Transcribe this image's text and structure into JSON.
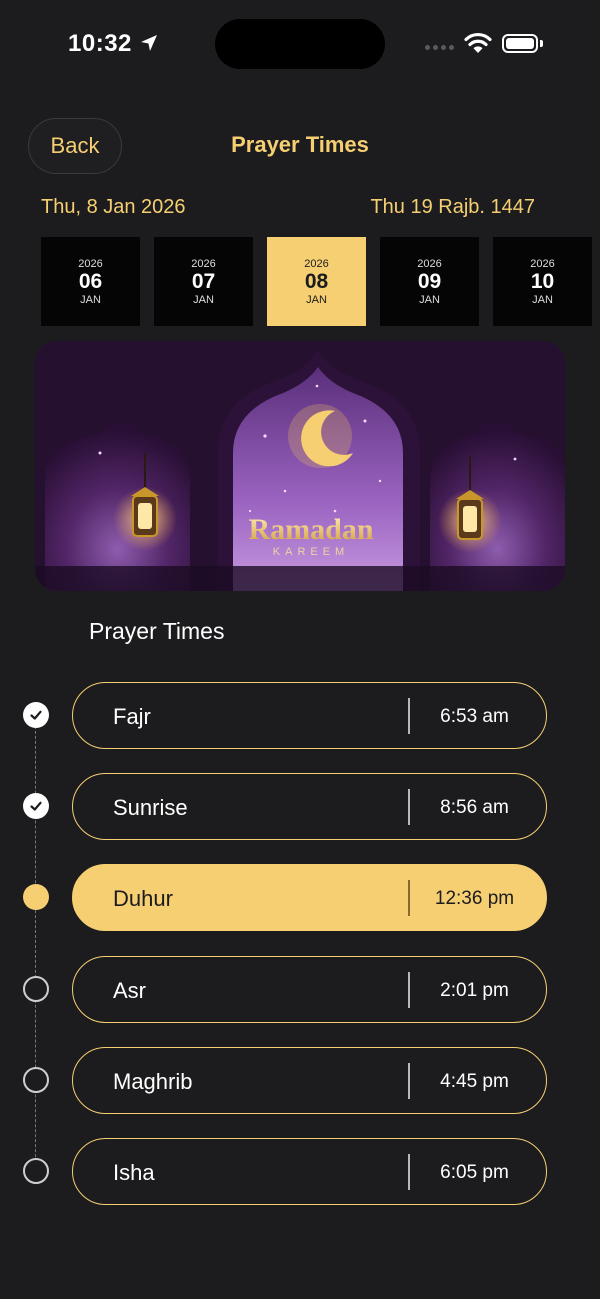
{
  "status_bar": {
    "time": "10:32"
  },
  "header": {
    "back_label": "Back",
    "title": "Prayer Times"
  },
  "dates": {
    "gregorian": "Thu, 8 Jan 2026",
    "hijri": "Thu 19 Rajb. 1447"
  },
  "date_strip": [
    {
      "year": "2026",
      "day": "06",
      "month": "JAN",
      "selected": false
    },
    {
      "year": "2026",
      "day": "07",
      "month": "JAN",
      "selected": false
    },
    {
      "year": "2026",
      "day": "08",
      "month": "JAN",
      "selected": true
    },
    {
      "year": "2026",
      "day": "09",
      "month": "JAN",
      "selected": false
    },
    {
      "year": "2026",
      "day": "10",
      "month": "JAN",
      "selected": false
    }
  ],
  "banner": {
    "title": "Ramadan",
    "subtitle": "KAREEM"
  },
  "section_title": "Prayer Times",
  "prayers": [
    {
      "name": "Fajr",
      "time": "6:53 am",
      "status": "done"
    },
    {
      "name": "Sunrise",
      "time": "8:56 am",
      "status": "done"
    },
    {
      "name": "Duhur",
      "time": "12:36 pm",
      "status": "current"
    },
    {
      "name": "Asr",
      "time": "2:01 pm",
      "status": "upcoming"
    },
    {
      "name": "Maghrib",
      "time": "4:45 pm",
      "status": "upcoming"
    },
    {
      "name": "Isha",
      "time": "6:05 pm",
      "status": "upcoming"
    }
  ],
  "colors": {
    "accent": "#f6cf72",
    "background": "#1c1c1e"
  }
}
